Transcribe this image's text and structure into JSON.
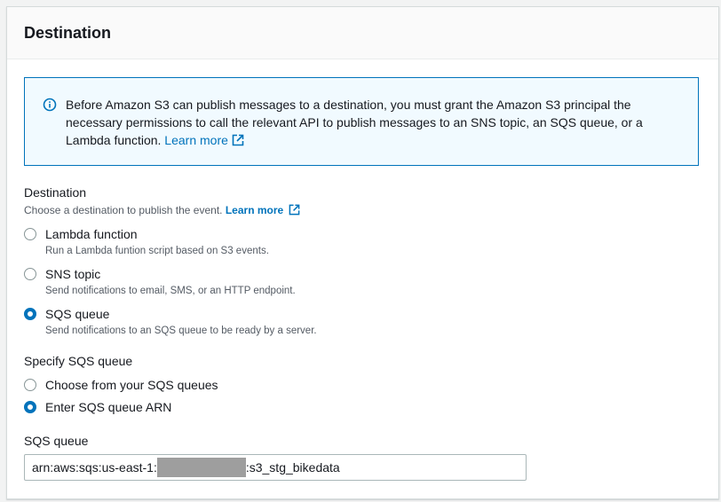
{
  "panel": {
    "title": "Destination"
  },
  "info": {
    "text": "Before Amazon S3 can publish messages to a destination, you must grant the Amazon S3 principal the necessary permissions to call the relevant API to publish messages to an SNS topic, an SQS queue, or a Lambda function.",
    "link_label": "Learn more"
  },
  "destination": {
    "label": "Destination",
    "description": "Choose a destination to publish the event.",
    "link_label": "Learn more",
    "options": [
      {
        "label": "Lambda function",
        "description": "Run a Lambda funtion script based on S3 events.",
        "selected": false
      },
      {
        "label": "SNS topic",
        "description": "Send notifications to email, SMS, or an HTTP endpoint.",
        "selected": false
      },
      {
        "label": "SQS queue",
        "description": "Send notifications to an SQS queue to be ready by a server.",
        "selected": true
      }
    ]
  },
  "specify": {
    "label": "Specify SQS queue",
    "options": [
      {
        "label": "Choose from your SQS queues",
        "selected": false
      },
      {
        "label": "Enter SQS queue ARN",
        "selected": true
      }
    ]
  },
  "queue": {
    "label": "SQS queue",
    "value_prefix": "arn:aws:sqs:us-east-1:",
    "value_suffix": ":s3_stg_bikedata"
  },
  "colors": {
    "accent": "#0073bb",
    "info_bg": "#f1faff",
    "border": "#aab7b8"
  }
}
